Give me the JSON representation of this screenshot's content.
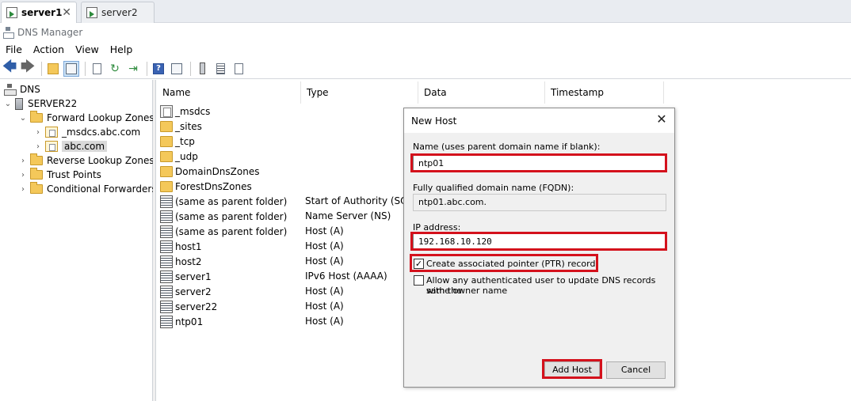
{
  "tabs": [
    {
      "label": "server1",
      "active": true
    },
    {
      "label": "server2",
      "active": false
    }
  ],
  "app_title": "DNS Manager",
  "menu": [
    "File",
    "Action",
    "View",
    "Help"
  ],
  "tree": {
    "root": "DNS",
    "server": "SERVER22",
    "forward_zones": "Forward Lookup Zones",
    "msdcs_zone": "_msdcs.abc.com",
    "abc_zone": "abc.com",
    "reverse_zones": "Reverse Lookup Zones",
    "trust_points": "Trust Points",
    "conditional_forwarders": "Conditional Forwarders"
  },
  "list": {
    "columns": [
      "Name",
      "Type",
      "Data",
      "Timestamp"
    ],
    "rows": [
      {
        "name": "_msdcs",
        "type": "",
        "icon": "msdcs-icon"
      },
      {
        "name": "_sites",
        "type": "",
        "icon": "folder-icon"
      },
      {
        "name": "_tcp",
        "type": "",
        "icon": "folder-icon"
      },
      {
        "name": "_udp",
        "type": "",
        "icon": "folder-icon"
      },
      {
        "name": "DomainDnsZones",
        "type": "",
        "icon": "folder-icon"
      },
      {
        "name": "ForestDnsZones",
        "type": "",
        "icon": "folder-icon"
      },
      {
        "name": "(same as parent folder)",
        "type": "Start of Authority (SOA)",
        "icon": "record-icon"
      },
      {
        "name": "(same as parent folder)",
        "type": "Name Server (NS)",
        "icon": "record-icon"
      },
      {
        "name": "(same as parent folder)",
        "type": "Host (A)",
        "icon": "record-icon"
      },
      {
        "name": "host1",
        "type": "Host (A)",
        "icon": "record-icon"
      },
      {
        "name": "host2",
        "type": "Host (A)",
        "icon": "record-icon"
      },
      {
        "name": "server1",
        "type": "IPv6 Host (AAAA)",
        "icon": "record-icon"
      },
      {
        "name": "server2",
        "type": "Host (A)",
        "icon": "record-icon"
      },
      {
        "name": "server22",
        "type": "Host (A)",
        "icon": "record-icon"
      },
      {
        "name": "ntp01",
        "type": "Host (A)",
        "icon": "record-icon"
      }
    ]
  },
  "dialog": {
    "title": "New Host",
    "name_label": "Name (uses parent domain name if blank):",
    "name_value": "ntp01",
    "fqdn_label": "Fully qualified domain name (FQDN):",
    "fqdn_value": "ntp01.abc.com.",
    "ip_label": "IP address:",
    "ip_value": "192.168.10.120",
    "ptr_label": "Create associated pointer (PTR) record",
    "ptr_checked": true,
    "allow_label_line1": "Allow any authenticated user to update DNS records with the",
    "allow_label_line2": "same owner name",
    "allow_checked": false,
    "add_button": "Add Host",
    "cancel_button": "Cancel"
  },
  "highlight_color": "#d4111c"
}
